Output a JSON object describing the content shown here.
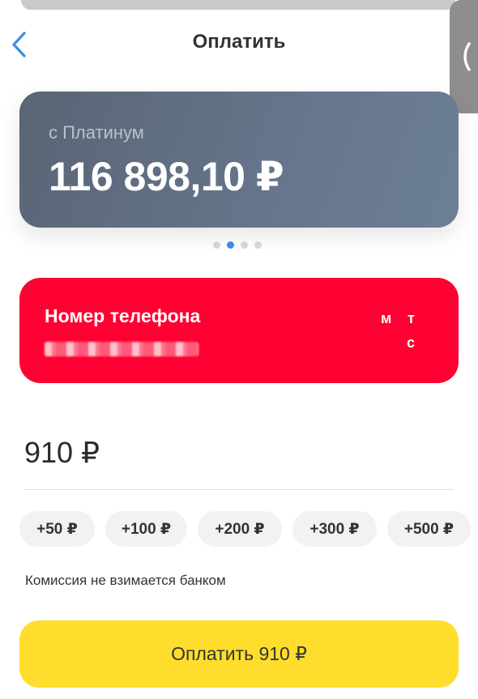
{
  "header": {
    "title": "Оплатить",
    "back_icon": "chevron-left-icon"
  },
  "side_tab": {
    "icon": "chevron-left-icon"
  },
  "account": {
    "name": "с Платинум",
    "balance": "116 898,10 ₽"
  },
  "carousel": {
    "page_count": 4,
    "active_index": 1
  },
  "payee": {
    "label": "Номер телефона",
    "phone_number": "+7 ••• ••• •• ••",
    "logo_letters": [
      "м",
      "т",
      "с"
    ]
  },
  "amount": {
    "value": "910 ₽"
  },
  "quick_amounts": [
    "+50 ₽",
    "+100 ₽",
    "+200 ₽",
    "+300 ₽",
    "+500 ₽"
  ],
  "commission_note": "Комиссия не взимается банком",
  "pay_button": {
    "label": "Оплатить 910 ₽"
  },
  "colors": {
    "accent_blue": "#3d8be8",
    "mts_red": "#ff0032",
    "pay_yellow": "#ffdd2d",
    "card_slate": "#65748a"
  }
}
